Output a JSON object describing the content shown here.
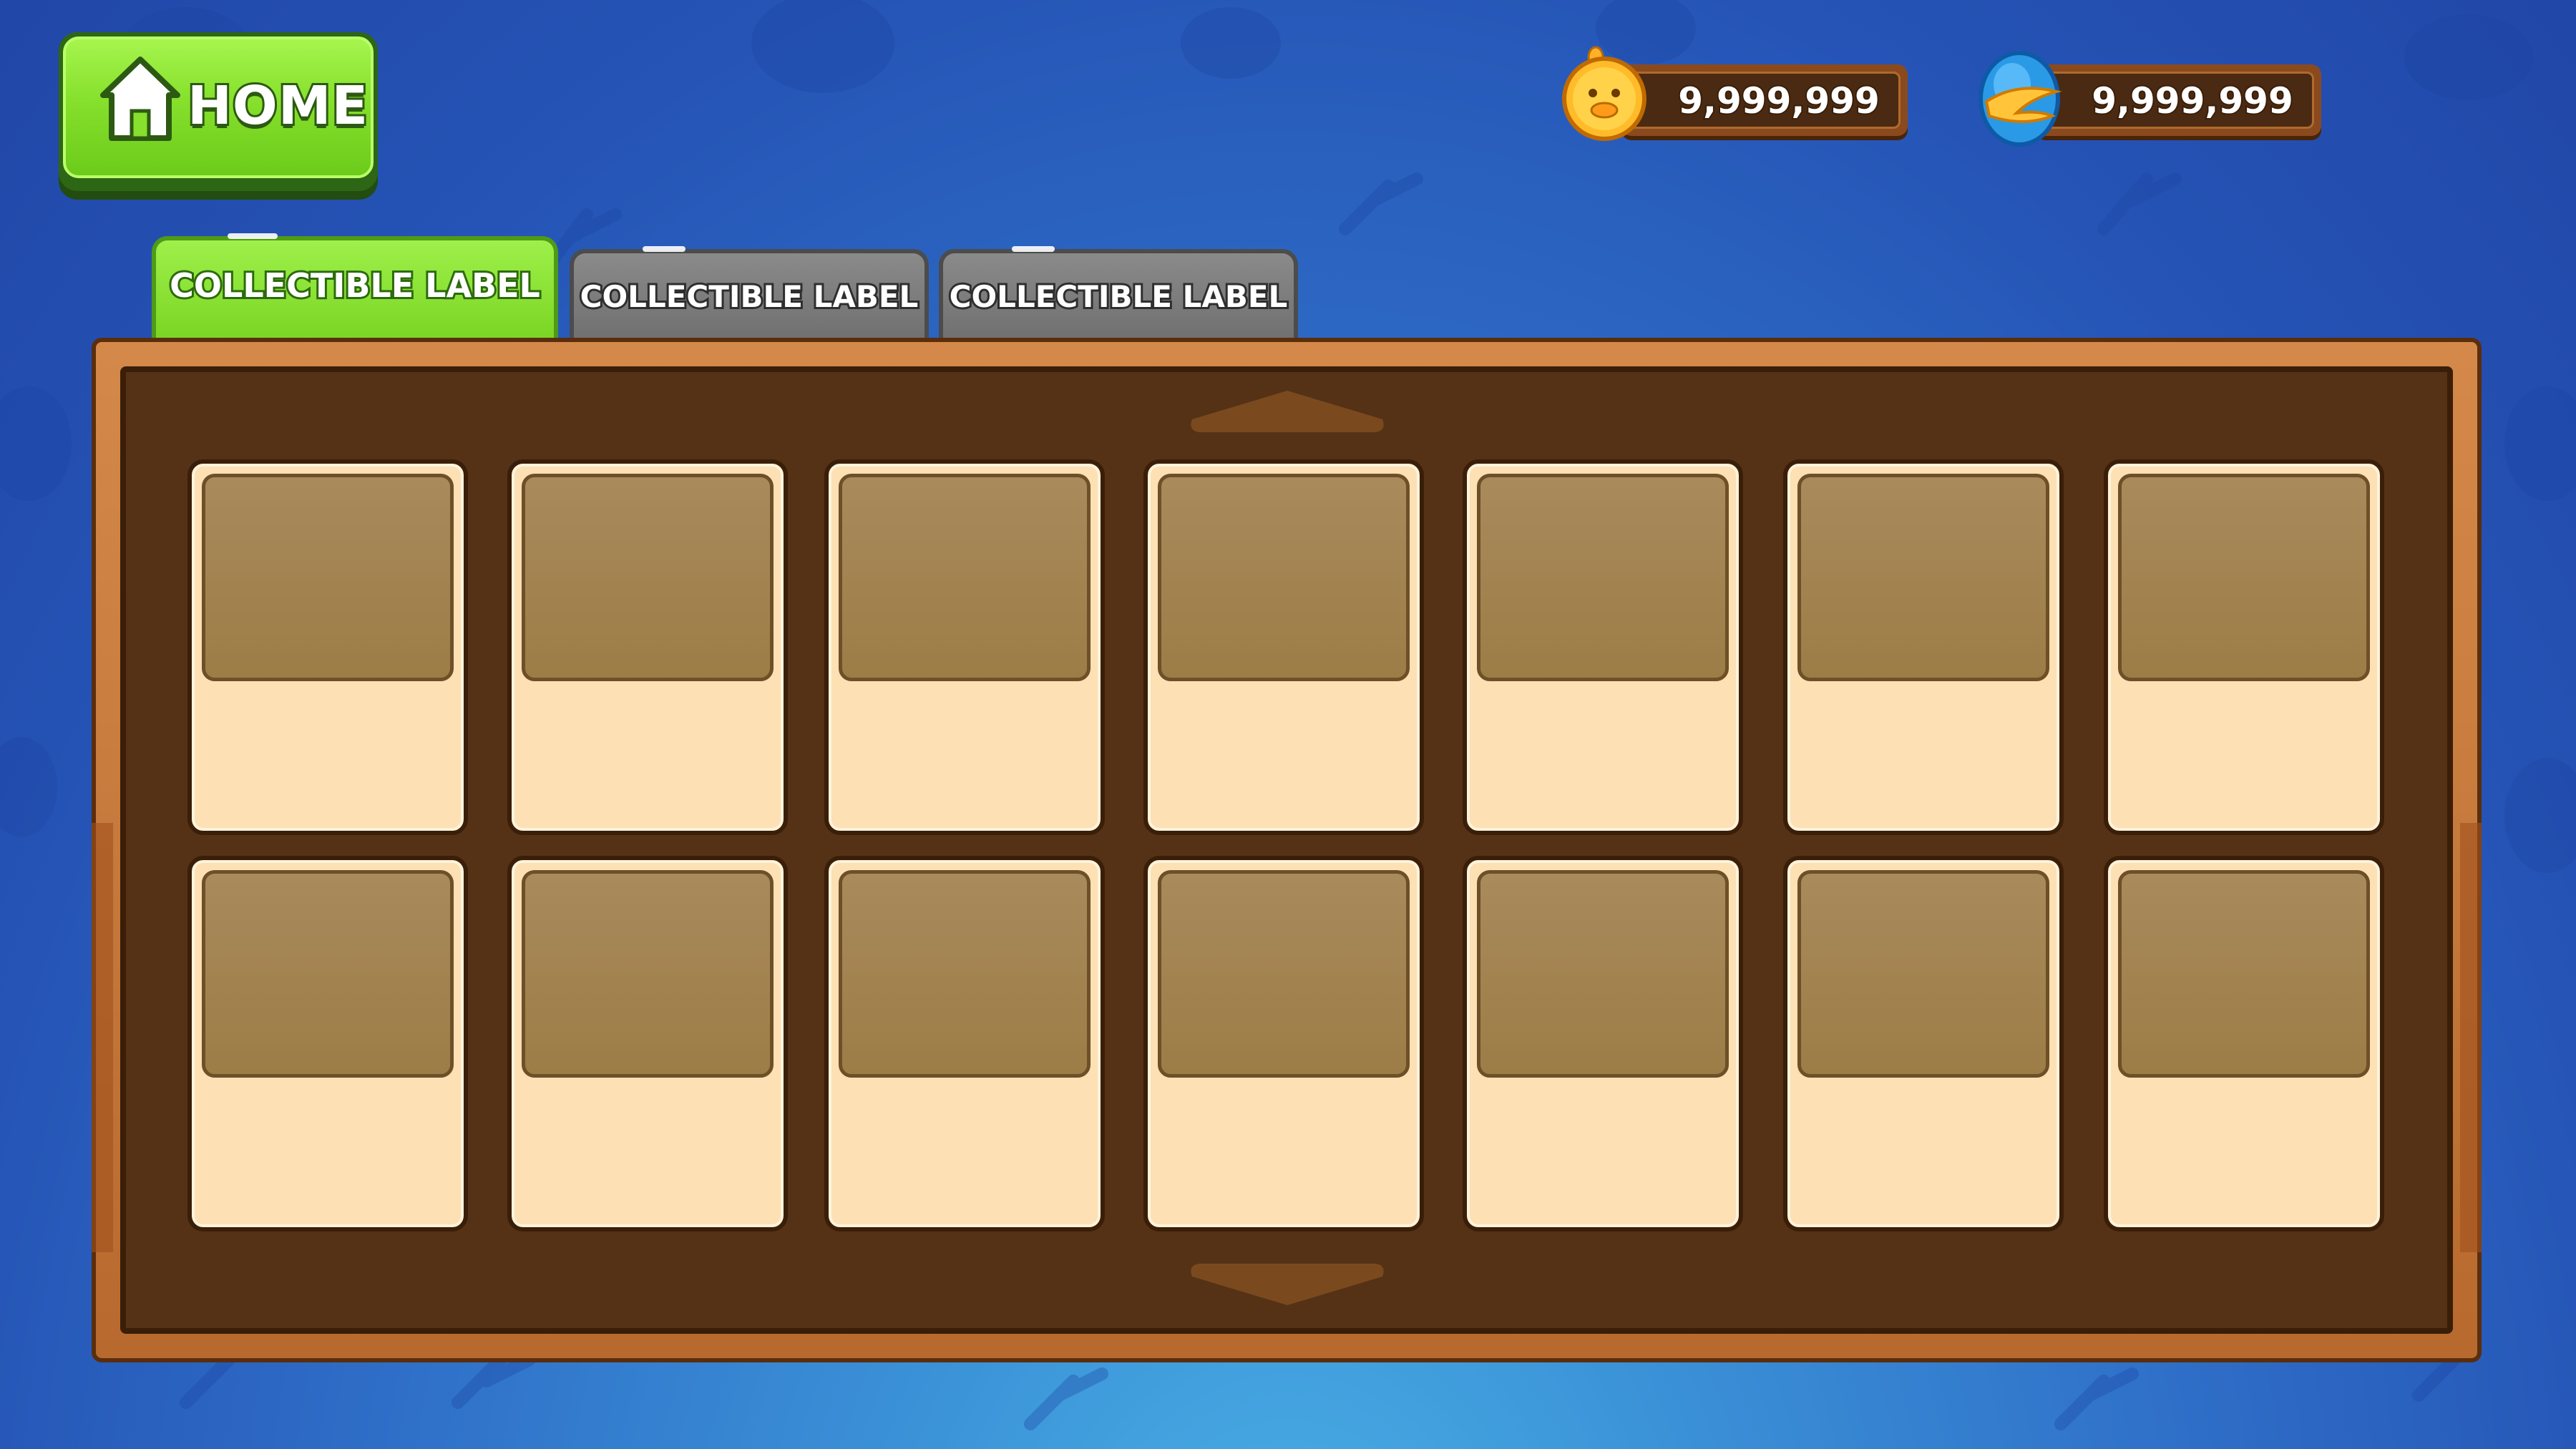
{
  "header": {
    "home_label": "HOME"
  },
  "currencies": [
    {
      "icon": "chick-coin-icon",
      "value": "9,999,999"
    },
    {
      "icon": "bird-gem-icon",
      "value": "9,999,999"
    }
  ],
  "tabs": [
    {
      "label": "COLLECTIBLE LABEL",
      "active": true
    },
    {
      "label": "COLLECTIBLE LABEL",
      "active": false
    },
    {
      "label": "COLLECTIBLE LABEL",
      "active": false
    }
  ],
  "grid": {
    "rows": 2,
    "columns": 7,
    "cards": [
      "",
      "",
      "",
      "",
      "",
      "",
      "",
      "",
      "",
      "",
      "",
      "",
      "",
      ""
    ]
  },
  "colors": {
    "accent_green": "#86e02c",
    "panel_wood": "#b86a2e",
    "panel_dark": "#553216",
    "card_fill": "#fde0b4",
    "card_slot": "#a88a5c",
    "background_blue": "#2554b6"
  }
}
